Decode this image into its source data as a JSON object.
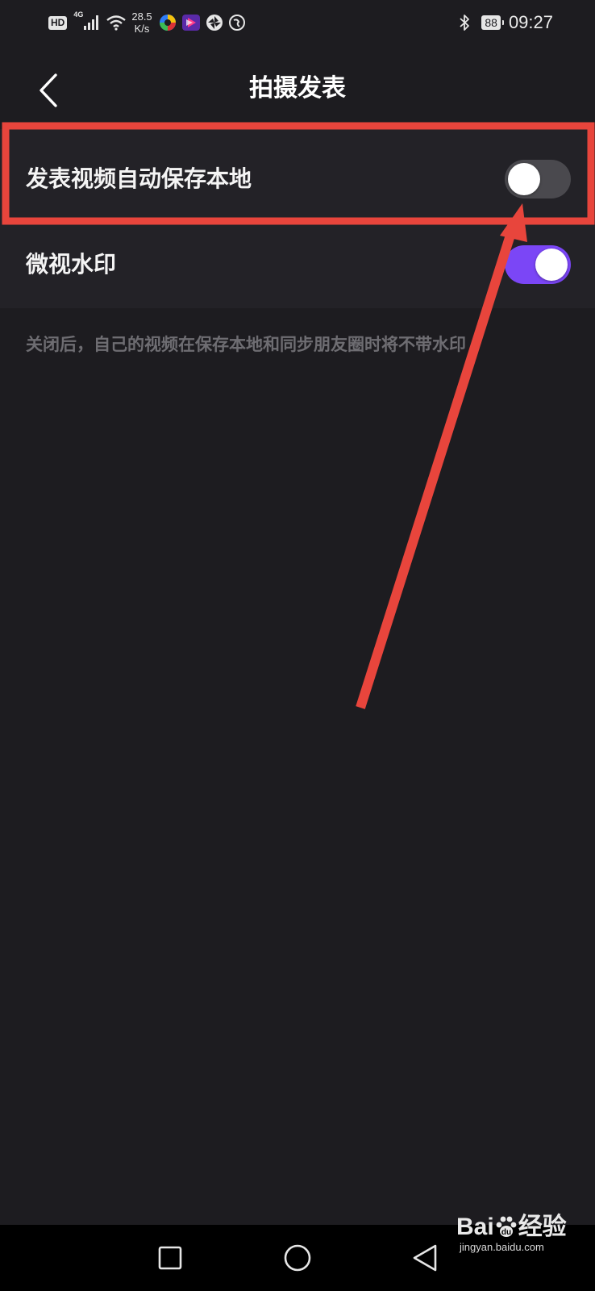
{
  "status_bar": {
    "hd_label": "HD",
    "network_label": "4G",
    "speed_value": "28.5",
    "speed_unit": "K/s",
    "battery": "88",
    "time": "09:27"
  },
  "header": {
    "back_icon": "chevron-left-icon",
    "title": "拍摄发表"
  },
  "settings": [
    {
      "label": "发表视频自动保存本地",
      "enabled": false
    },
    {
      "label": "微视水印",
      "enabled": true
    }
  ],
  "hint": "关闭后，自己的视频在保存本地和同步朋友圈时将不带水印",
  "annotation": {
    "color": "#e8453c"
  },
  "nav_bar": {
    "recent_icon": "square-icon",
    "home_icon": "circle-icon",
    "back_icon": "triangle-back-icon"
  },
  "watermark": {
    "logo_text": "Bai",
    "logo_text_2": "经验",
    "url": "jingyan.baidu.com"
  },
  "colors": {
    "background": "#1d1c20",
    "card": "#232227",
    "toggle_on": "#7b46f6",
    "toggle_off": "#4a494e",
    "hint": "#6e6d72"
  }
}
